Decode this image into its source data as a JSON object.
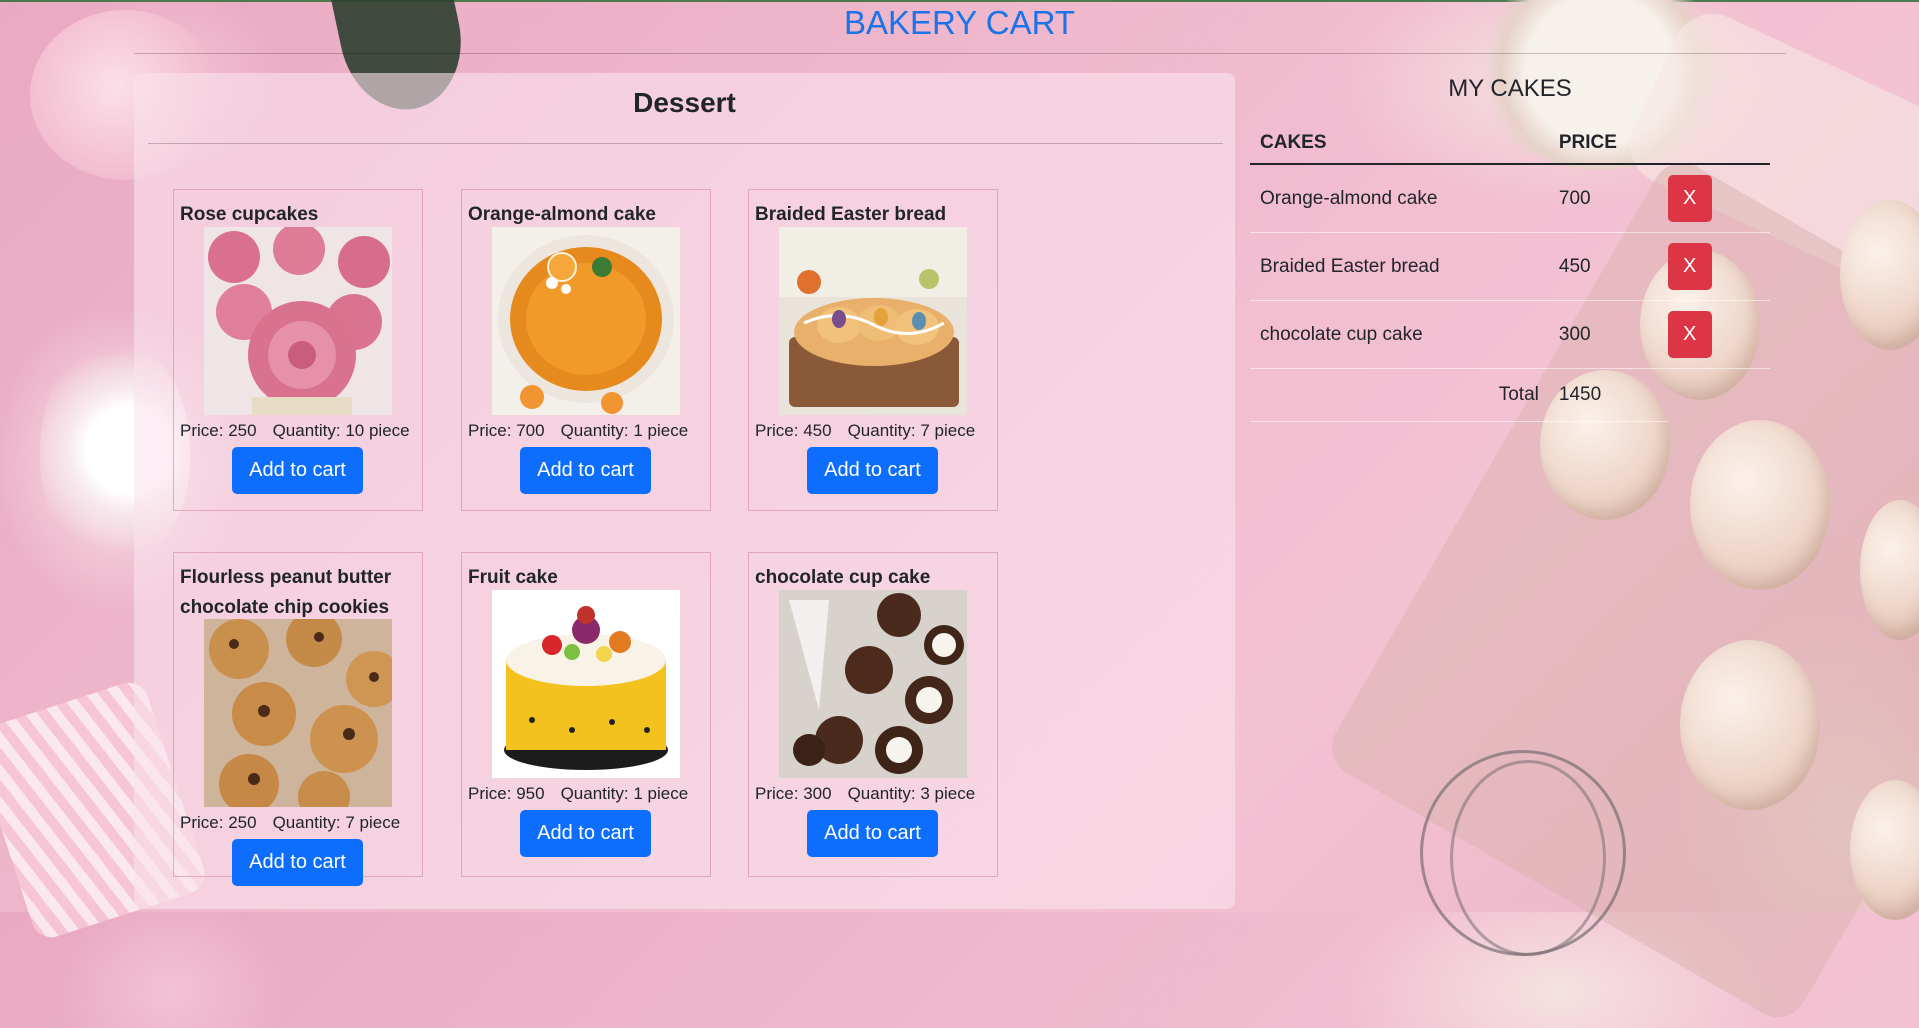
{
  "header": {
    "title": "BAKERY CART"
  },
  "dessert": {
    "title": "Dessert",
    "price_prefix": "Price: ",
    "qty_prefix": "Quantity: ",
    "products": [
      {
        "name": "Rose cupcakes",
        "price": "250",
        "quantity": "10 piece",
        "button": "Add to cart",
        "image": "rose-cupcakes-photo"
      },
      {
        "name": "Orange-almond cake",
        "price": "700",
        "quantity": "1 piece",
        "button": "Add to cart",
        "image": "orange-almond-cake-photo"
      },
      {
        "name": "Braided Easter bread",
        "price": "450",
        "quantity": "7 piece",
        "button": "Add to cart",
        "image": "braided-easter-bread-photo"
      },
      {
        "name": "Flourless peanut butter chocolate chip cookies",
        "price": "250",
        "quantity": "7 piece",
        "button": "Add to cart",
        "image": "cookies-photo"
      },
      {
        "name": "Fruit cake",
        "price": "950",
        "quantity": "1 piece",
        "button": "Add to cart",
        "image": "fruit-cake-photo"
      },
      {
        "name": "chocolate cup cake",
        "price": "300",
        "quantity": "3 piece",
        "button": "Add to cart",
        "image": "chocolate-cupcakes-photo"
      }
    ]
  },
  "cart": {
    "title": "MY CAKES",
    "columns": {
      "cakes": "CAKES",
      "price": "PRICE"
    },
    "items": [
      {
        "name": "Orange-almond cake",
        "price": "700",
        "remove": "X"
      },
      {
        "name": "Braided Easter bread",
        "price": "450",
        "remove": "X"
      },
      {
        "name": "chocolate cup cake",
        "price": "300",
        "remove": "X"
      }
    ],
    "total_label": "Total",
    "total_value": "1450"
  },
  "colors": {
    "title_blue": "#1a73e8",
    "button_blue": "#0d6efd",
    "remove_red": "#dc3545",
    "background_pink": "#f0b9cd"
  }
}
